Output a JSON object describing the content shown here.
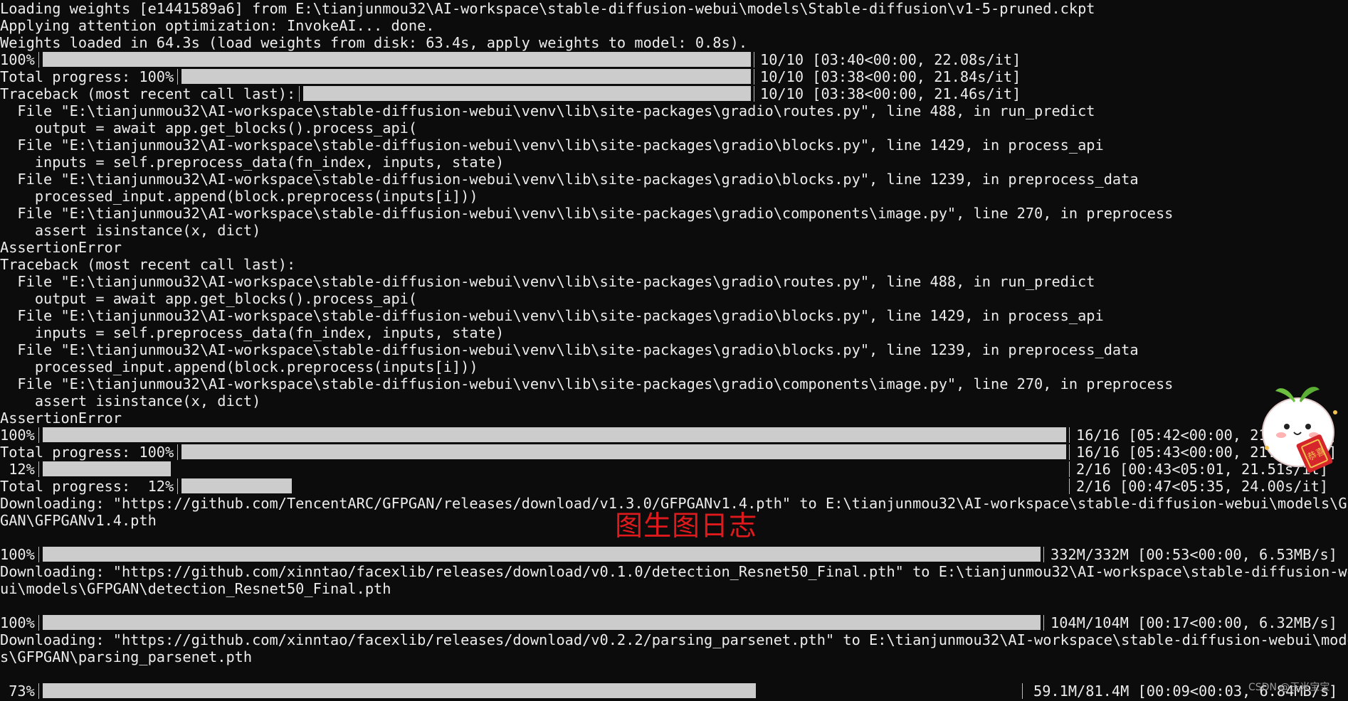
{
  "terminal": {
    "lines": [
      "Loading weights [e1441589a6] from E:\\tianjunmou32\\AI-workspace\\stable-diffusion-webui\\models\\Stable-diffusion\\v1-5-pruned.ckpt",
      "Applying attention optimization: InvokeAI... done.",
      "Weights loaded in 64.3s (load weights from disk: 63.4s, apply weights to model: 0.8s).",
      {
        "bar": true,
        "label": "100%",
        "progress": 1.0,
        "track": "long",
        "sep": "pre",
        "stats": "10/10 [03:40<00:00, 22.08s/it]"
      },
      {
        "bar": true,
        "label": "Total progress: 100%",
        "progress": 1.0,
        "track": "long",
        "sep": "pre",
        "stats": "10/10 [03:38<00:00, 21.84s/it]"
      },
      {
        "bar": true,
        "label": "Traceback (most recent call last):",
        "progress": 1.0,
        "track": "long",
        "sep": "pre",
        "stats": "10/10 [03:38<00:00, 21.46s/it]"
      },
      "  File \"E:\\tianjunmou32\\AI-workspace\\stable-diffusion-webui\\venv\\lib\\site-packages\\gradio\\routes.py\", line 488, in run_predict",
      "    output = await app.get_blocks().process_api(",
      "  File \"E:\\tianjunmou32\\AI-workspace\\stable-diffusion-webui\\venv\\lib\\site-packages\\gradio\\blocks.py\", line 1429, in process_api",
      "    inputs = self.preprocess_data(fn_index, inputs, state)",
      "  File \"E:\\tianjunmou32\\AI-workspace\\stable-diffusion-webui\\venv\\lib\\site-packages\\gradio\\blocks.py\", line 1239, in preprocess_data",
      "    processed_input.append(block.preprocess(inputs[i]))",
      "  File \"E:\\tianjunmou32\\AI-workspace\\stable-diffusion-webui\\venv\\lib\\site-packages\\gradio\\components\\image.py\", line 270, in preprocess",
      "    assert isinstance(x, dict)",
      "AssertionError",
      "Traceback (most recent call last):",
      "  File \"E:\\tianjunmou32\\AI-workspace\\stable-diffusion-webui\\venv\\lib\\site-packages\\gradio\\routes.py\", line 488, in run_predict",
      "    output = await app.get_blocks().process_api(",
      "  File \"E:\\tianjunmou32\\AI-workspace\\stable-diffusion-webui\\venv\\lib\\site-packages\\gradio\\blocks.py\", line 1429, in process_api",
      "    inputs = self.preprocess_data(fn_index, inputs, state)",
      "  File \"E:\\tianjunmou32\\AI-workspace\\stable-diffusion-webui\\venv\\lib\\site-packages\\gradio\\blocks.py\", line 1239, in preprocess_data",
      "    processed_input.append(block.preprocess(inputs[i]))",
      "  File \"E:\\tianjunmou32\\AI-workspace\\stable-diffusion-webui\\venv\\lib\\site-packages\\gradio\\components\\image.py\", line 270, in preprocess",
      "    assert isinstance(x, dict)",
      "AssertionError",
      {
        "bar": true,
        "label": "100%",
        "progress": 1.0,
        "track": "wide",
        "sep": "pre",
        "stats": "16/16 [05:42<00:00, 21.36s/it]"
      },
      {
        "bar": true,
        "label": "Total progress: 100%",
        "progress": 1.0,
        "track": "wide",
        "sep": "pre",
        "stats": "16/16 [05:43<00:00, 21.47s/it]"
      },
      {
        "bar": true,
        "label": " 12%",
        "progress": 0.125,
        "track": "wide",
        "sep": "post",
        "stats": "2/16 [00:43<05:01, 21.51s/it]"
      },
      {
        "bar": true,
        "label": "Total progress:  12%",
        "progress": 0.125,
        "track": "wide",
        "sep": "post",
        "stats": "2/16 [00:47<05:35, 24.00s/it]"
      },
      "Downloading: \"https://github.com/TencentARC/GFPGAN/releases/download/v1.3.0/GFPGANv1.4.pth\" to E:\\tianjunmou32\\AI-workspace\\stable-diffusion-webui\\models\\GFP",
      "GAN\\GFPGANv1.4.pth",
      "",
      {
        "bar": true,
        "label": "100%",
        "progress": 1.0,
        "track": "dl1",
        "sep": "pre",
        "stats": "332M/332M [00:53<00:00, 6.53MB/s]"
      },
      "Downloading: \"https://github.com/xinntao/facexlib/releases/download/v0.1.0/detection_Resnet50_Final.pth\" to E:\\tianjunmou32\\AI-workspace\\stable-diffusion-web",
      "ui\\models\\GFPGAN\\detection_Resnet50_Final.pth",
      "",
      {
        "bar": true,
        "label": "100%",
        "progress": 1.0,
        "track": "dl2",
        "sep": "pre",
        "stats": "104M/104M [00:17<00:00, 6.32MB/s]"
      },
      "Downloading: \"https://github.com/xinntao/facexlib/releases/download/v0.2.2/parsing_parsenet.pth\" to E:\\tianjunmou32\\AI-workspace\\stable-diffusion-webui\\model",
      "s\\GFPGAN\\parsing_parsenet.pth",
      "",
      {
        "bar": true,
        "label": " 73%",
        "progress": 0.73,
        "track": "dl3",
        "sep": "post",
        "stats": "59.1M/81.4M [00:09<00:03, 6.84MB/s]"
      }
    ]
  },
  "overlay": {
    "caption": "图生图日志",
    "watermark": "CSDN @玉米宝宝",
    "sticker_text": "恭喜"
  },
  "colors": {
    "background": "#0c0c0c",
    "text": "#ececec",
    "bar": "#cccccc",
    "caption": "#e0191c"
  }
}
